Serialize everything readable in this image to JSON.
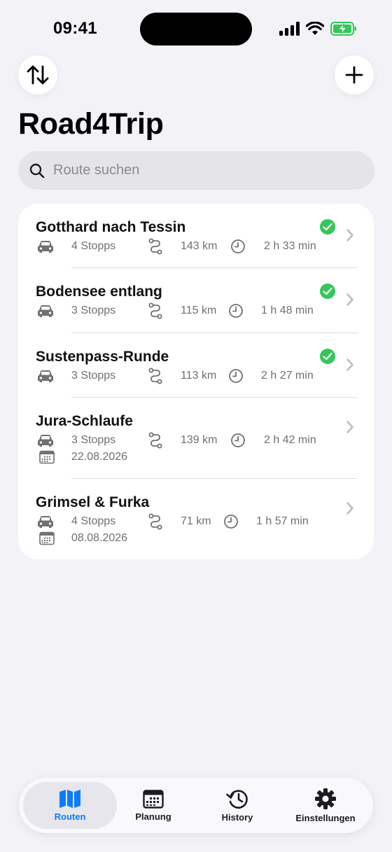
{
  "status": {
    "time": "09:41"
  },
  "header": {
    "title": "Road4Trip"
  },
  "search": {
    "placeholder": "Route suchen"
  },
  "routes": [
    {
      "name": "Gotthard nach Tessin",
      "stops": "4 Stopps",
      "distance": "143 km",
      "duration": "2 h 33 min",
      "done": true
    },
    {
      "name": "Bodensee entlang",
      "stops": "3 Stopps",
      "distance": "115 km",
      "duration": "1 h 48 min",
      "done": true
    },
    {
      "name": "Sustenpass-Runde",
      "stops": "3 Stopps",
      "distance": "113 km",
      "duration": "2 h 27 min",
      "done": true
    },
    {
      "name": "Jura-Schlaufe",
      "stops": "3 Stopps",
      "distance": "139 km",
      "duration": "2 h 42 min",
      "date": "22.08.2026",
      "done": false
    },
    {
      "name": "Grimsel & Furka",
      "stops": "4 Stopps",
      "distance": "71 km",
      "duration": "1 h 57 min",
      "date": "08.08.2026",
      "done": false
    }
  ],
  "tabs": [
    {
      "label": "Routen",
      "icon": "map-icon",
      "active": true
    },
    {
      "label": "Planung",
      "icon": "calendar-icon",
      "active": false
    },
    {
      "label": "History",
      "icon": "history-icon",
      "active": false
    },
    {
      "label": "Einstellungen",
      "icon": "gear-icon",
      "active": false
    }
  ],
  "colors": {
    "accent": "#0a7cff",
    "success": "#34c759",
    "background": "#f2f2f7"
  }
}
